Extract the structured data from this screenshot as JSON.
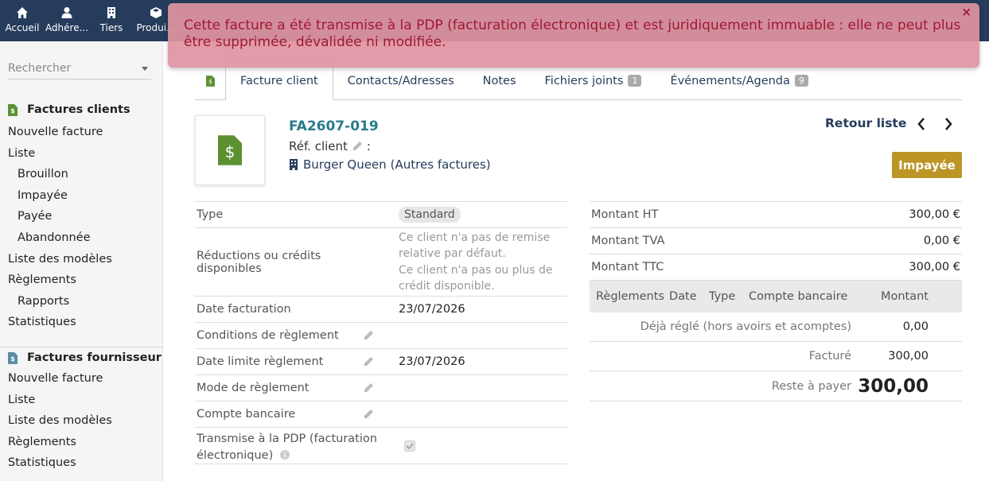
{
  "topmenu": [
    {
      "label": "Accueil",
      "icon": "home-icon"
    },
    {
      "label": "Adhére...",
      "icon": "user-icon"
    },
    {
      "label": "Tiers",
      "icon": "building-icon"
    },
    {
      "label": "Produi...",
      "icon": "box-icon"
    }
  ],
  "sidebar": {
    "search_placeholder": "Rechercher",
    "customer_invoices": {
      "title": "Factures clients",
      "items": [
        "Nouvelle facture",
        "Liste",
        "Brouillon",
        "Impayée",
        "Payée",
        "Abandonnée",
        "Liste des modèles",
        "Règlements",
        "Rapports",
        "Statistiques"
      ]
    },
    "supplier_invoices": {
      "title": "Factures fournisseur",
      "items": [
        "Nouvelle facture",
        "Liste",
        "Liste des modèles",
        "Règlements",
        "Statistiques"
      ]
    }
  },
  "tabs": {
    "invoice": "Facture client",
    "contacts": "Contacts/Adresses",
    "notes": "Notes",
    "files": "Fichiers joints",
    "files_count": "1",
    "events": "Événements/Agenda",
    "events_count": "9"
  },
  "invoice": {
    "ref": "FA2607-019",
    "ref_client_label": "Réf. client",
    "ref_client_suffix": ":",
    "thirdparty": "Burger Queen",
    "other_invoices": "(Autres factures)",
    "back_to_list": "Retour liste",
    "status": "Impayée"
  },
  "fields": {
    "type_label": "Type",
    "type_value": "Standard",
    "discount_label": "Réductions ou crédits disponibles",
    "discount_line1": "Ce client n'a pas de remise relative par défaut.",
    "discount_line2": "Ce client n'a pas ou plus de crédit disponible.",
    "date_label": "Date facturation",
    "date_value": "23/07/2026",
    "conditions_label": "Conditions de règlement",
    "due_label": "Date limite règlement",
    "due_value": "23/07/2026",
    "mode_label": "Mode de règlement",
    "bank_label": "Compte bancaire",
    "pdp_label": "Transmise à la PDP (facturation électronique)"
  },
  "amounts": {
    "ht_label": "Montant HT",
    "ht_value": "300,00 €",
    "tva_label": "Montant TVA",
    "tva_value": "0,00 €",
    "ttc_label": "Montant TTC",
    "ttc_value": "300,00 €"
  },
  "payments": {
    "headers": [
      "Règlements",
      "Date",
      "Type",
      "Compte bancaire",
      "Montant"
    ],
    "already_paid_label": "Déjà réglé (hors avoirs et acomptes)",
    "already_paid_value": "0,00",
    "billed_label": "Facturé",
    "billed_value": "300,00",
    "remaining_label": "Reste à payer",
    "remaining_value": "300,00"
  },
  "notice": {
    "message": "Cette facture a été transmise à la PDP (facturation électronique) et est juridiquement immuable : elle ne peut plus être supprimée, dévalidée ni modifiée.",
    "close": "×"
  },
  "colors": {
    "topbar": "#263c5c",
    "status_unpaid": "#bc9526",
    "notice_bg": "#e093a3",
    "remaining": "#8a0f0f"
  }
}
